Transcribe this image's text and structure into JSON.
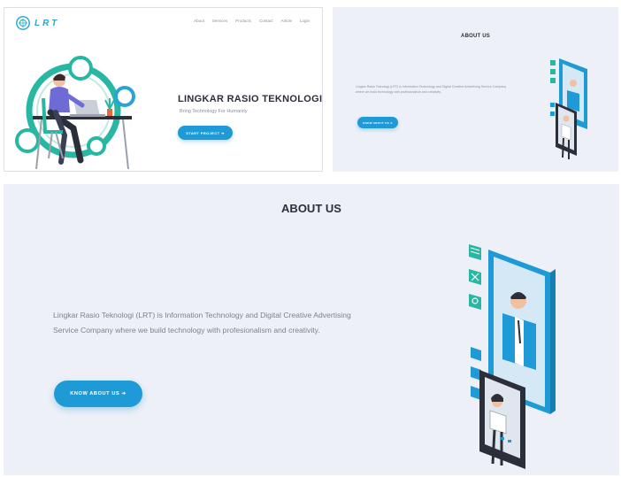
{
  "hero": {
    "logo_text": "LRT",
    "nav": [
      "About",
      "Services",
      "Products",
      "Contact",
      "Article",
      "Login"
    ],
    "title": "LINGKAR RASIO TEKNOLOGI",
    "subtitle": "Bring Technology For Humanity",
    "cta_label": "START PROJECT ➔"
  },
  "about_small": {
    "title": "ABOUT US",
    "paragraph": "Lingkar Rasio Teknologi (LRT) is Information Technology and Digital Creative Advertising Service Company where we build technology with profesionalism and creativity.",
    "cta_label": "KNOW ABOUT US ➔"
  },
  "about_large": {
    "title": "ABOUT US",
    "paragraph": "Lingkar Rasio Teknologi (LRT) is Information Technology and Digital Creative Advertising Service Company where we build technology with profesionalism and creativity.",
    "cta_label": "KNOW ABOUT US ➔"
  },
  "colors": {
    "brand_blue": "#1e9ad6",
    "teal": "#27b7a3",
    "section_bg": "#eef0f8",
    "heading": "#2b2f3a",
    "muted_text": "#8a8f9c"
  },
  "icons": {
    "logo": "circle-logo-icon",
    "hero_illustration": "developer-at-desk-illustration",
    "about_illustration": "people-in-phone-screens-illustration"
  }
}
